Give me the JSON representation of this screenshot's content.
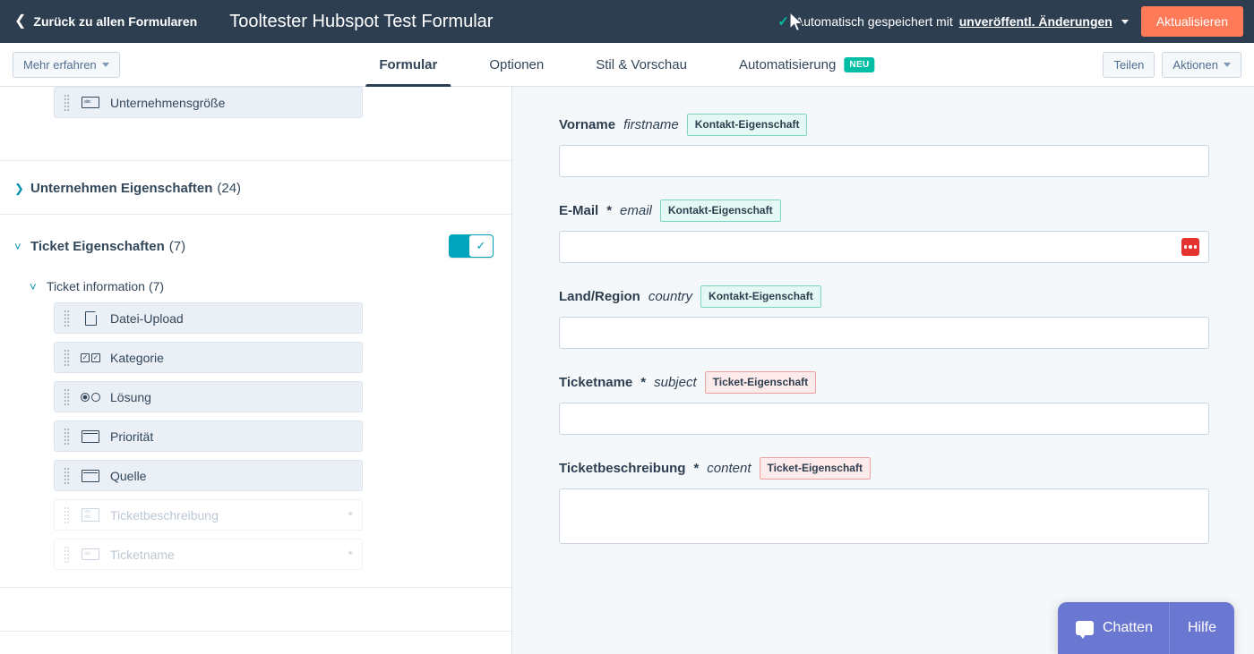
{
  "topbar": {
    "back_label": "Zurück zu allen Formularen",
    "back_icon": "chevron-left-icon",
    "title": "Tooltester Hubspot Test Formular",
    "autosave_check_icon": "check-icon",
    "autosave_text": "Automatisch gespeichert mit",
    "autosave_link": "unveröffentl. Änderungen",
    "autosave_caret_icon": "caret-down-icon",
    "update_button": "Aktualisieren",
    "accent_orange": "#ff7a59",
    "bg": "#2d3e50"
  },
  "tabbar": {
    "learn_more": "Mehr erfahren",
    "learn_more_caret_icon": "caret-down-icon",
    "tabs": [
      {
        "label": "Formular",
        "active": true,
        "badge": ""
      },
      {
        "label": "Optionen",
        "active": false,
        "badge": ""
      },
      {
        "label": "Stil & Vorschau",
        "active": false,
        "badge": ""
      },
      {
        "label": "Automatisierung",
        "active": false,
        "badge": "NEU"
      }
    ],
    "share": "Teilen",
    "actions": "Aktionen",
    "actions_caret_icon": "caret-down-icon",
    "badge_color": "#00bda5"
  },
  "sidebar": {
    "top_field": {
      "label": "Unternehmensgröße",
      "icon": "abc-textbox-icon",
      "grip_icon": "drag-handle-icon",
      "disabled": false,
      "required": false
    },
    "sections": [
      {
        "twisty_icon": "chevron-right-icon",
        "expanded": false,
        "title": "Unternehmen Eigenschaften",
        "count": "(24)",
        "has_toggle": false
      },
      {
        "twisty_icon": "chevron-down-icon",
        "expanded": true,
        "title": "Ticket Eigenschaften",
        "count": "(7)",
        "has_toggle": true,
        "toggle_on": true,
        "toggle_color": "#00a4bd",
        "subsection": {
          "twisty_icon": "chevron-down-icon",
          "title": "Ticket information",
          "count": "(7)"
        },
        "fields": [
          {
            "label": "Datei-Upload",
            "icon": "file-icon",
            "disabled": false,
            "required": false
          },
          {
            "label": "Kategorie",
            "icon": "checkbox-icon",
            "disabled": false,
            "required": false
          },
          {
            "label": "Lösung",
            "icon": "radio-icon",
            "disabled": false,
            "required": false
          },
          {
            "label": "Priorität",
            "icon": "select-icon",
            "disabled": false,
            "required": false
          },
          {
            "label": "Quelle",
            "icon": "select-icon",
            "disabled": false,
            "required": false
          },
          {
            "label": "Ticketbeschreibung",
            "icon": "textarea-icon",
            "disabled": true,
            "required": true,
            "required_mark": "*"
          },
          {
            "label": "Ticketname",
            "icon": "abc-textbox-icon",
            "disabled": true,
            "required": true,
            "required_mark": "*"
          }
        ]
      }
    ]
  },
  "preview": {
    "fields": [
      {
        "label": "Vorname",
        "required_mark": "",
        "internal_name": "firstname",
        "tag": "Kontakt-Eigenschaft",
        "tag_type": "contact",
        "value": "",
        "tall": false,
        "password_icon": false
      },
      {
        "label": "E-Mail",
        "required_mark": "*",
        "internal_name": "email",
        "tag": "Kontakt-Eigenschaft",
        "tag_type": "contact",
        "value": "",
        "tall": false,
        "password_icon": true,
        "password_icon_name": "password-manager-icon",
        "password_icon_color": "#e3342f"
      },
      {
        "label": "Land/Region",
        "required_mark": "",
        "internal_name": "country",
        "tag": "Kontakt-Eigenschaft",
        "tag_type": "contact",
        "value": "",
        "tall": false,
        "password_icon": false
      },
      {
        "label": "Ticketname",
        "required_mark": "*",
        "internal_name": "subject",
        "tag": "Ticket-Eigenschaft",
        "tag_type": "ticket",
        "value": "",
        "tall": false,
        "password_icon": false
      },
      {
        "label": "Ticketbeschreibung",
        "required_mark": "*",
        "internal_name": "content",
        "tag": "Ticket-Eigenschaft",
        "tag_type": "ticket",
        "value": "",
        "tall": true,
        "password_icon": false
      }
    ]
  },
  "chat": {
    "chat_label": "Chatten",
    "chat_icon": "chat-bubble-icon",
    "help_label": "Hilfe",
    "color": "#6a78d1"
  }
}
